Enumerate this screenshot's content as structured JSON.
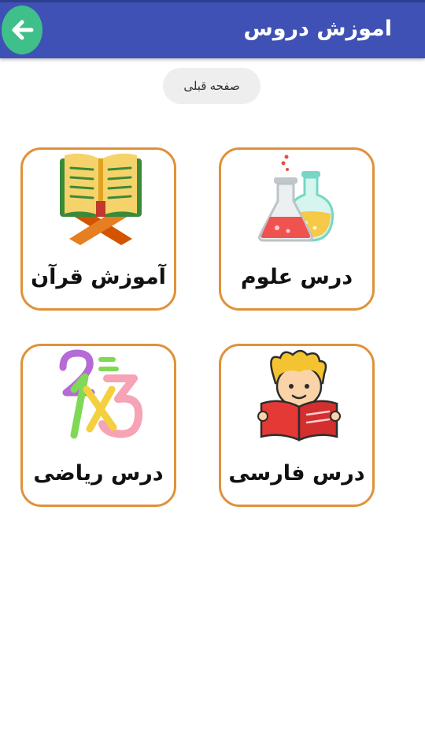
{
  "header": {
    "title": "اموزش دروس",
    "back_icon": "arrow-left-icon",
    "back_color": "#3fbf8a",
    "bar_color": "#3f51b5"
  },
  "prev_page_button": {
    "label": "صفحه قبلی"
  },
  "cards": [
    {
      "id": "quran",
      "label": "آموزش قرآن",
      "icon": "quran-book-icon"
    },
    {
      "id": "science",
      "label": "درس علوم",
      "icon": "lab-flasks-icon"
    },
    {
      "id": "math",
      "label": "درس ریاضی",
      "icon": "numbers-icon"
    },
    {
      "id": "persian",
      "label": "درس فارسی",
      "icon": "reading-boy-icon"
    }
  ],
  "colors": {
    "card_border": "#e0913a",
    "button_bg": "#eeeeee"
  }
}
